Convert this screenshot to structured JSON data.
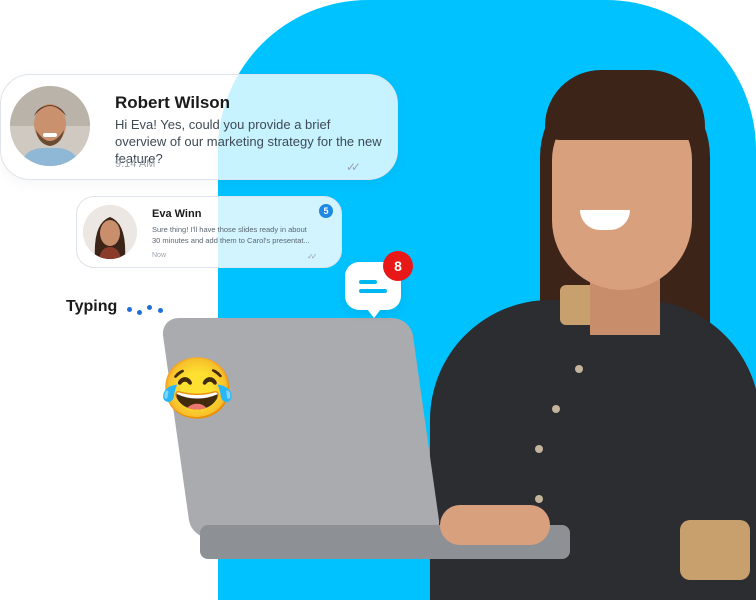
{
  "messages": {
    "primary": {
      "name": "Robert Wilson",
      "text": "Hi Eva! Yes, could you provide a brief overview of our marketing strategy for the new feature?",
      "time": "9:14 AM",
      "status_icon": "double-check-icon"
    },
    "secondary": {
      "name": "Eva Winn",
      "text_line1": "Sure thing! I'll have those slides ready in about",
      "text_line2": "30 minutes and add them to Carol's presentat...",
      "time": "Now",
      "unread_count": "5",
      "status_icon": "double-check-icon"
    }
  },
  "typing": {
    "label": "Typing"
  },
  "notification": {
    "count": "8",
    "icon": "chat-bubble-icon"
  },
  "emoji": {
    "symbol": "😂",
    "name": "laughing-tears-emoji"
  },
  "colors": {
    "hero_background": "#00c2ff",
    "badge_red": "#e81818",
    "badge_blue": "#1e88e5",
    "typing_dots": "#1e6fd9"
  }
}
